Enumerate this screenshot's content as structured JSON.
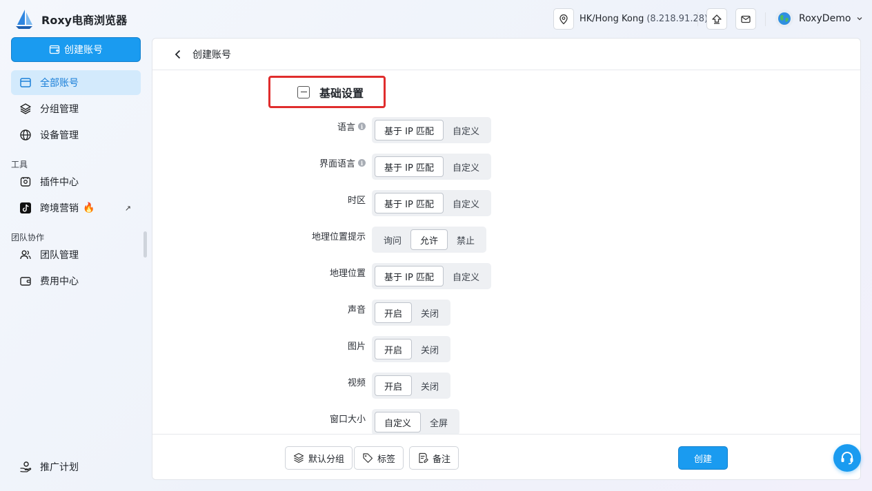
{
  "app": {
    "title": "Roxy电商浏览器"
  },
  "sidebar": {
    "create_label": "创建账号",
    "items": [
      {
        "label": "全部账号",
        "icon": "window-icon"
      },
      {
        "label": "分组管理",
        "icon": "layers-icon"
      },
      {
        "label": "设备管理",
        "icon": "globe-icon"
      }
    ],
    "tools_heading": "工具",
    "tools": [
      {
        "label": "插件中心",
        "icon": "plugin-icon"
      },
      {
        "label": "跨境营销",
        "icon": "tiktok-icon",
        "badge_icon": "fire-icon",
        "external_icon": "arrow-up-right-icon"
      }
    ],
    "team_heading": "团队协作",
    "team": [
      {
        "label": "团队管理",
        "icon": "users-icon"
      },
      {
        "label": "费用中心",
        "icon": "wallet-icon"
      }
    ],
    "bottom_item": {
      "label": "推广计划",
      "icon": "gift-hand-icon"
    }
  },
  "topbar": {
    "location": "HK/Hong Kong",
    "ip": "(8.218.91.28)",
    "user_name": "RoxyDemo"
  },
  "page": {
    "title": "创建账号",
    "section_title": "基础设置",
    "settings": [
      {
        "label": "语言",
        "info": "i",
        "options": [
          "基于 IP 匹配",
          "自定义"
        ],
        "selected": 0
      },
      {
        "label": "界面语言",
        "info": "i",
        "options": [
          "基于 IP 匹配",
          "自定义"
        ],
        "selected": 0
      },
      {
        "label": "时区",
        "options": [
          "基于 IP 匹配",
          "自定义"
        ],
        "selected": 0
      },
      {
        "label": "地理位置提示",
        "options": [
          "询问",
          "允许",
          "禁止"
        ],
        "selected": 1
      },
      {
        "label": "地理位置",
        "options": [
          "基于 IP 匹配",
          "自定义"
        ],
        "selected": 0
      },
      {
        "label": "声音",
        "options": [
          "开启",
          "关闭"
        ],
        "selected": 0
      },
      {
        "label": "图片",
        "options": [
          "开启",
          "关闭"
        ],
        "selected": 0
      },
      {
        "label": "视频",
        "options": [
          "开启",
          "关闭"
        ],
        "selected": 0
      },
      {
        "label": "窗口大小",
        "options": [
          "自定义",
          "全屏"
        ],
        "selected": 0
      }
    ],
    "footer": {
      "group_label": "默认分组",
      "tag_label": "标签",
      "note_label": "备注",
      "submit_label": "创建"
    }
  },
  "colors": {
    "accent": "#1a9bf0",
    "highlight_box": "#e02d2d",
    "active_nav_bg": "#d3eafc"
  }
}
